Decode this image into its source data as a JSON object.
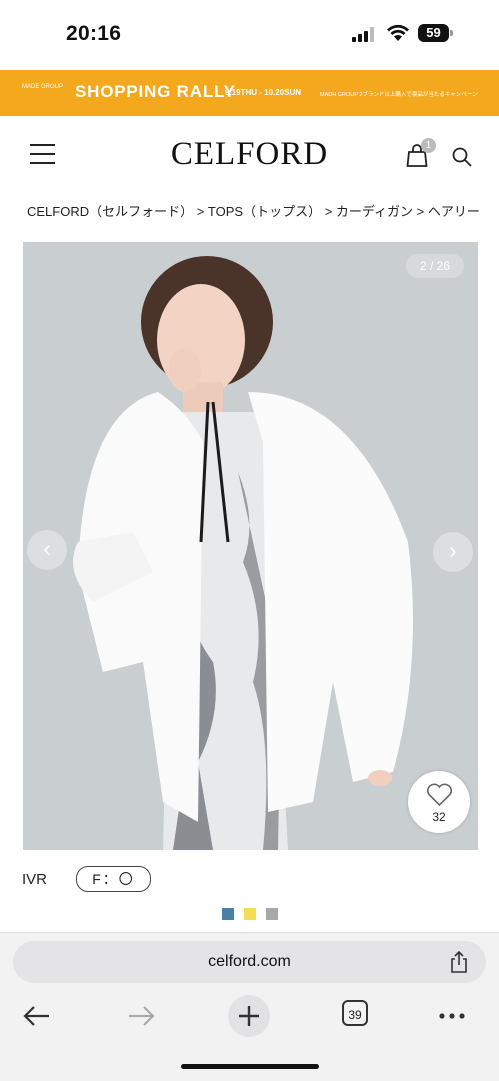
{
  "status": {
    "time": "20:16",
    "battery": "59"
  },
  "banner": {
    "logo": "MADE GROUP",
    "title": "SHOPPING RALLY",
    "dates": "9.19THU - 10.20SUN",
    "note": "MADH GROUP 2ブランド以上購入で豪品が当たるキャンペーン"
  },
  "header": {
    "brand": "CELFORD",
    "cart_count": "1"
  },
  "breadcrumb": "CELFORD（セルフォード） > TOPS（トップス） > カーディガン > ヘアリー",
  "gallery": {
    "counter": "2 / 26",
    "prev": "‹",
    "next": "›"
  },
  "favorite": {
    "count": "32"
  },
  "product": {
    "color": "IVR",
    "size": "F：〇"
  },
  "colors": [
    "#4a7fa8",
    "#f1de52",
    "#a8a8a8"
  ],
  "browser": {
    "url": "celford.com",
    "tabs_count": "39"
  }
}
